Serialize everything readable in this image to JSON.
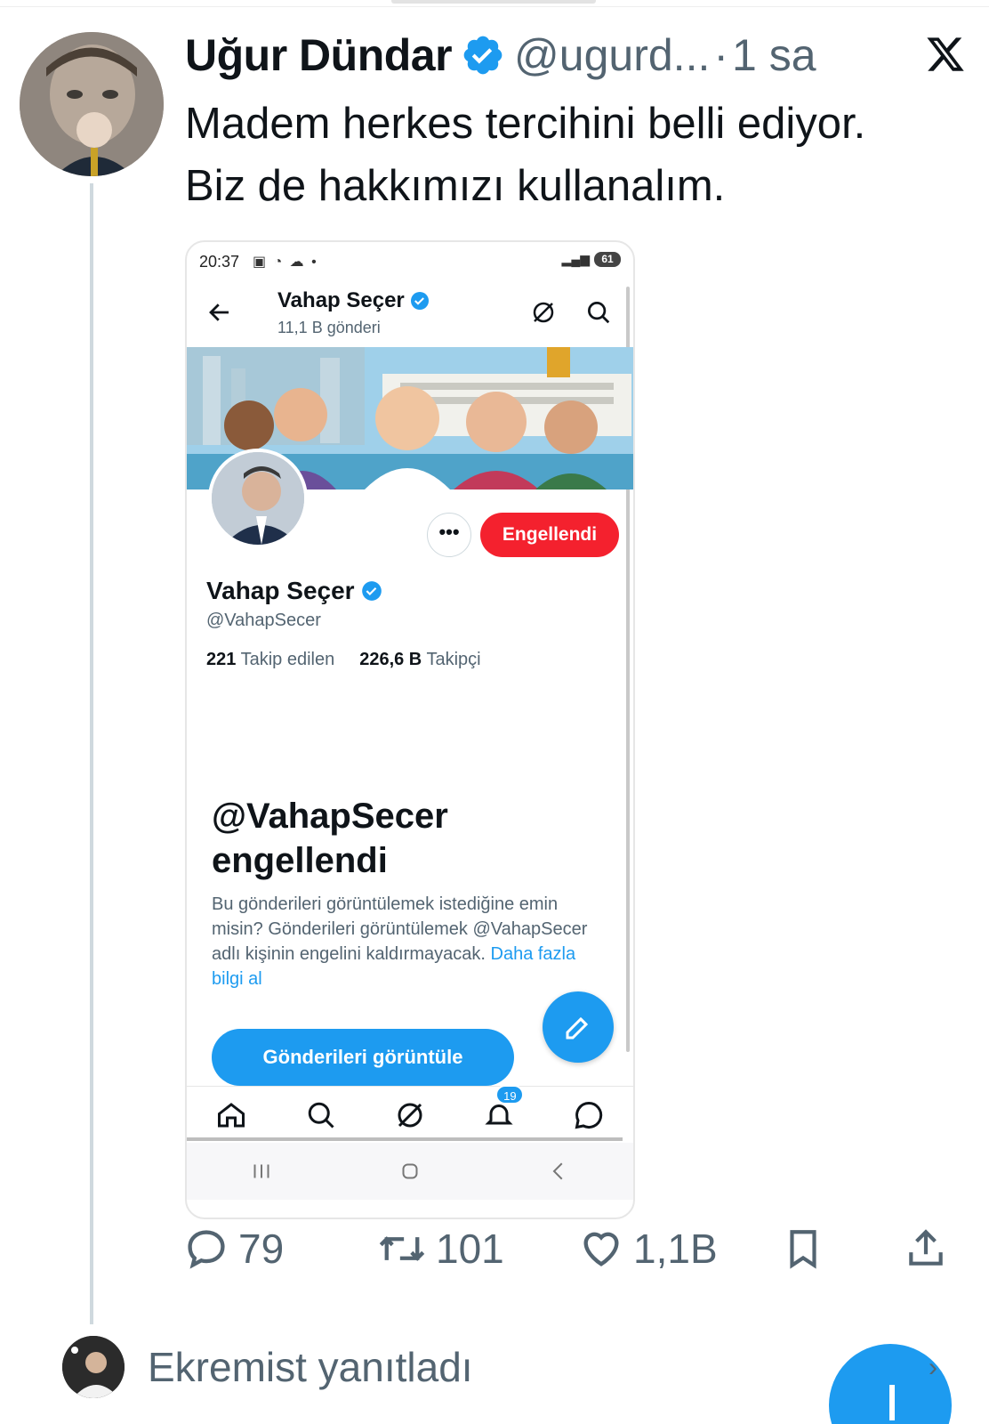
{
  "tweet": {
    "author_name": "Uğur Dündar",
    "handle": "@ugurd...",
    "separator": "·",
    "time": "1 sa",
    "text_line1": "Madem herkes tercihini belli ediyor.",
    "text_line2": "Biz de hakkımızı kullanalım.",
    "verified_icon": "verified-badge-icon",
    "platform_icon": "x-logo-icon"
  },
  "embedded": {
    "status_time": "20:37",
    "battery": "61",
    "profile_title": "Vahap Seçer",
    "posts_count": "11,1 B gönderi",
    "more_label": "•••",
    "blocked_button": "Engellendi",
    "display_name": "Vahap Seçer",
    "handle": "@VahapSecer",
    "following_count": "221",
    "following_label": "Takip edilen",
    "followers_count": "226,6 B",
    "followers_label": "Takipçi",
    "block_title_line1": "@VahapSecer",
    "block_title_line2": "engellendi",
    "block_text": "Bu gönderileri görüntülemek istediğine emin misin? Gönderileri görüntülemek @VahapSecer adlı kişinin engelini kaldırmayacak.",
    "block_link": "Daha fazla bilgi al",
    "view_posts_button": "Gönderileri görüntüle",
    "notification_badge": "19",
    "colors": {
      "accent": "#1d9bf0",
      "blocked": "#f4212e"
    }
  },
  "actions": {
    "replies": "79",
    "reposts": "101",
    "likes": "1,1B"
  },
  "reply_row": {
    "text": "Ekremist yanıtladı"
  }
}
